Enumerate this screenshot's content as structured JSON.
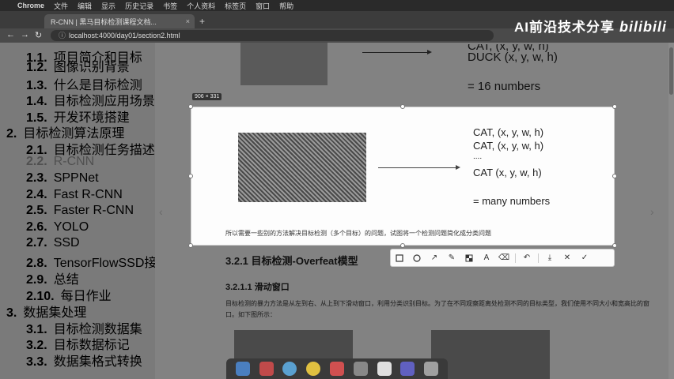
{
  "menubar": {
    "apple": "",
    "items": [
      "Chrome",
      "文件",
      "编辑",
      "显示",
      "历史记录",
      "书签",
      "个人资料",
      "标签页",
      "窗口",
      "帮助"
    ]
  },
  "tab": {
    "title": "R-CNN | 黑马目标检测课程文档..."
  },
  "address": {
    "url": "localhost:4000/day01/section2.html"
  },
  "watermark": {
    "text": "AI前沿技术分享",
    "logo": "bilibili"
  },
  "sidebar": {
    "items": [
      {
        "num": "1.1.",
        "label": "项目简介和目标"
      },
      {
        "num": "1.2.",
        "label": "图像识别背景"
      },
      {
        "num": "1.3.",
        "label": "什么是目标检测"
      },
      {
        "num": "1.4.",
        "label": "目标检测应用场景"
      },
      {
        "num": "1.5.",
        "label": "开发环境搭建"
      },
      {
        "num": "2.",
        "label": "目标检测算法原理"
      },
      {
        "num": "2.1.",
        "label": "目标检测任务描述"
      },
      {
        "num": "2.2.",
        "label": "R-CNN"
      },
      {
        "num": "2.3.",
        "label": "SPPNet"
      },
      {
        "num": "2.4.",
        "label": "Fast R-CNN"
      },
      {
        "num": "2.5.",
        "label": "Faster R-CNN"
      },
      {
        "num": "2.6.",
        "label": "YOLO"
      },
      {
        "num": "2.7.",
        "label": "SSD"
      },
      {
        "num": "2.8.",
        "label": "TensorFlowSSD接口"
      },
      {
        "num": "2.9.",
        "label": "总结"
      },
      {
        "num": "2.10.",
        "label": "每日作业"
      },
      {
        "num": "3.",
        "label": "数据集处理"
      },
      {
        "num": "3.1.",
        "label": "目标检测数据集"
      },
      {
        "num": "3.2.",
        "label": "目标数据标记"
      },
      {
        "num": "3.3.",
        "label": "数据集格式转换"
      }
    ]
  },
  "background": {
    "line1": "CAT, (x, y, w, h)",
    "line2": "DUCK (x, y, w, h)",
    "line3": "= 16 numbers"
  },
  "capture": {
    "size": "906 × 331",
    "line1": "CAT, (x, y, w, h)",
    "line2": "CAT, (x, y, w, h)",
    "line3": "....",
    "line4": "CAT (x, y, w, h)",
    "line5": "= many numbers",
    "caption": "所以需要一些别的方法解决目标检测（多个目标）的问题，试图将一个检测问题简化成分类问题"
  },
  "toolbar": {
    "icons": [
      "rectangle-icon",
      "ellipse-icon",
      "arrow-icon",
      "pen-icon",
      "mosaic-icon",
      "text-icon",
      "eraser-icon",
      "undo-icon",
      "download-icon",
      "close-icon",
      "confirm-icon"
    ]
  },
  "article": {
    "h3": "3.2.1 目标检测-Overfeat模型",
    "h4": "3.2.1.1 滑动窗口",
    "para": "目标检测的暴力方法是从左到右、从上到下滑动窗口，利用分类识别目标。为了在不同观察距离处检测不同的目标类型，我们使用不同大小和宽高比的窗口。如下图所示："
  }
}
